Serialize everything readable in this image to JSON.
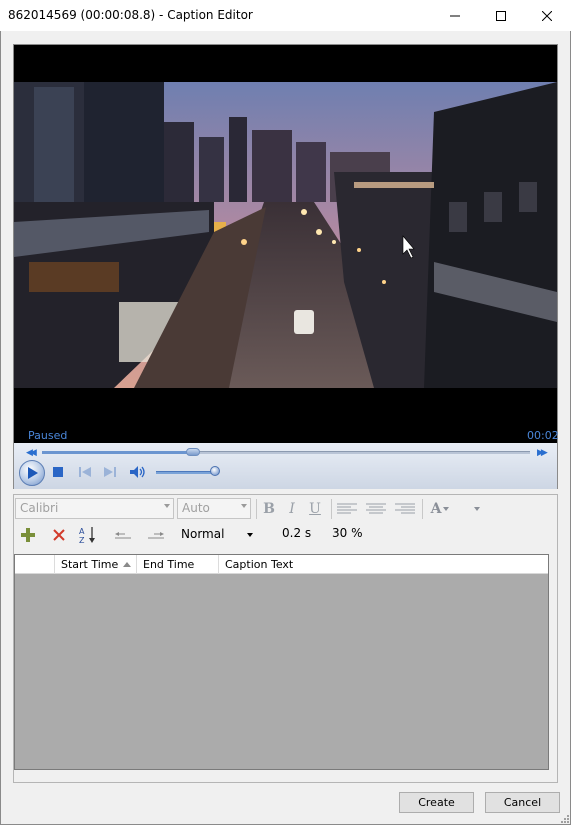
{
  "window": {
    "title": "862014569 (00:00:08.8) - Caption Editor",
    "controls": [
      "minimize-icon",
      "maximize-icon",
      "close-icon"
    ]
  },
  "player": {
    "status": "Paused",
    "time": "00:02",
    "seek_progress": 0.31,
    "volume_level": 0.9,
    "controls": [
      "play-icon",
      "stop-icon",
      "previous-icon",
      "next-icon",
      "volume-icon"
    ]
  },
  "format_toolbar": {
    "font": "Calibri",
    "font_size": "Auto",
    "bold": "B",
    "italic": "I",
    "underline": "U",
    "font_color": "A"
  },
  "caption_toolbar": {
    "speed": "Normal",
    "time_step": "0.2 s",
    "percent": "30 %"
  },
  "table": {
    "columns": [
      "",
      "Start Time",
      "End Time",
      "Caption Text"
    ],
    "rows": []
  },
  "buttons": {
    "create": "Create",
    "cancel": "Cancel"
  },
  "colors": {
    "status_text": "#4a86d8",
    "grid_background": "#ababab"
  }
}
